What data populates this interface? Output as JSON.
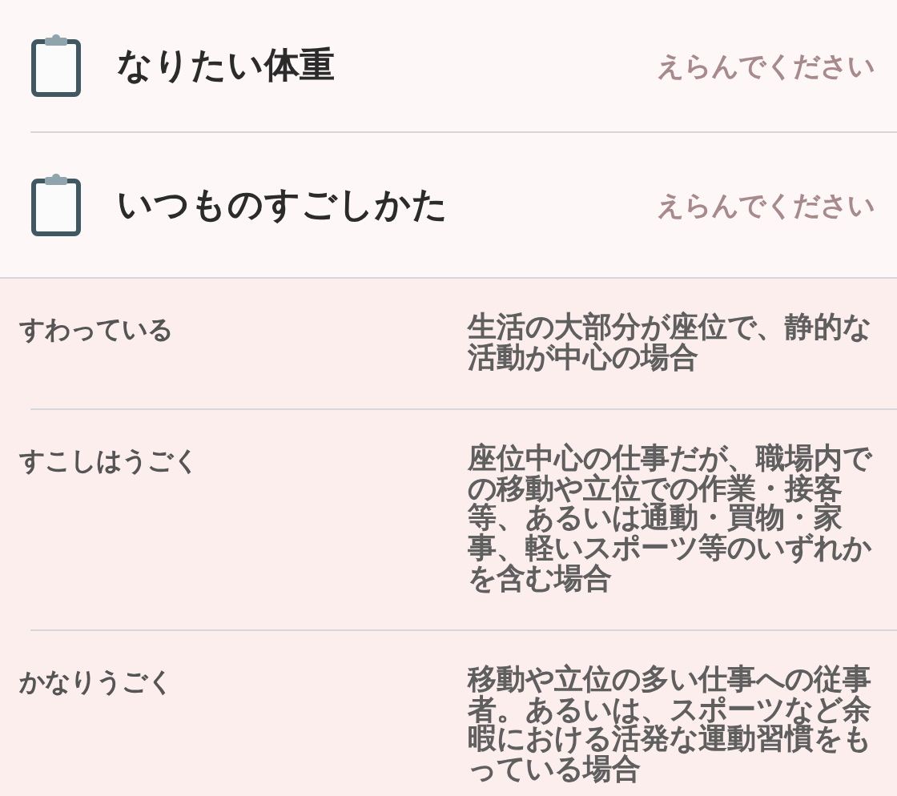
{
  "settings": [
    {
      "label": "なりたい体重",
      "prompt": "えらんでください"
    },
    {
      "label": "いつものすごしかた",
      "prompt": "えらんでください"
    }
  ],
  "activity_levels": [
    {
      "name": "すわっている",
      "description": "生活の大部分が座位で、静的な活動が中心の場合"
    },
    {
      "name": "すこしはうごく",
      "description": "座位中心の仕事だが、職場内での移動や立位での作業・接客等、あるいは通動・買物・家事、軽いスポーツ等のいずれかを含む場合"
    },
    {
      "name": "かなりうごく",
      "description": "移動や立位の多い仕事への従事者。あるいは、スポーツなど余暇における活発な運動習慣をもっている場合"
    }
  ]
}
